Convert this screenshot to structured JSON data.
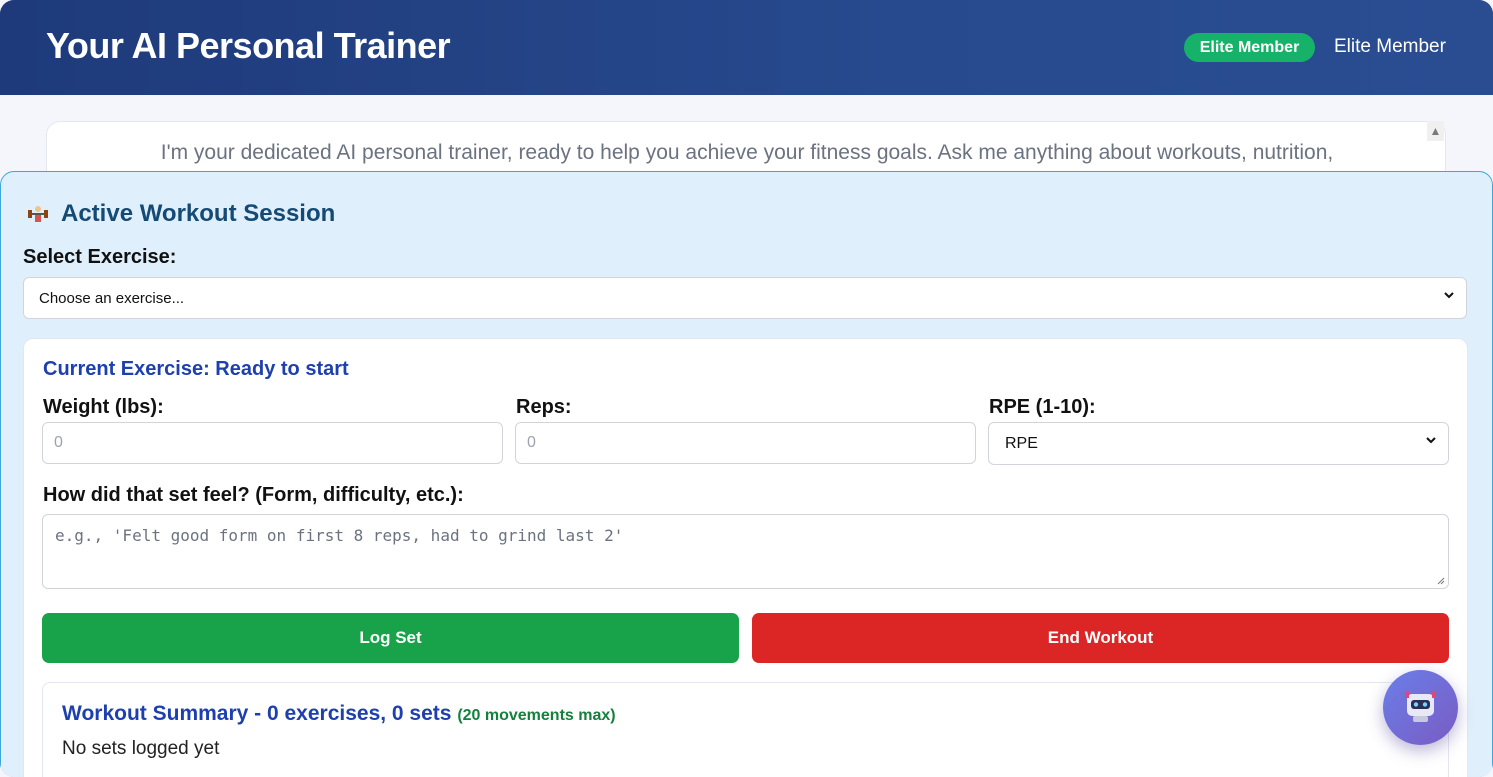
{
  "header": {
    "title": "Your AI Personal Trainer",
    "badge": "Elite Member",
    "member_label": "Elite Member"
  },
  "intro": {
    "text": "I'm your dedicated AI personal trainer, ready to help you achieve your fitness goals. Ask me anything about workouts, nutrition,"
  },
  "workout": {
    "icon": "weightlifter-icon",
    "title": "Active Workout Session",
    "select_label": "Select Exercise:",
    "select_value": "Choose an exercise...",
    "current_exercise": "Current Exercise: Ready to start",
    "weight_label": "Weight (lbs):",
    "weight_placeholder": "0",
    "reps_label": "Reps:",
    "reps_placeholder": "0",
    "rpe_label": "RPE (1-10):",
    "rpe_value": "RPE",
    "feel_label": "How did that set feel? (Form, difficulty, etc.):",
    "feel_placeholder": "e.g., 'Felt good form on first 8 reps, had to grind last 2'",
    "log_button": "Log Set",
    "end_button": "End Workout"
  },
  "summary": {
    "title": "Workout Summary - 0 exercises, 0 sets",
    "max_note": "(20 movements max)",
    "empty": "No sets logged yet"
  },
  "colors": {
    "header": "#274a8e",
    "badge": "#17b26a",
    "log_button": "#18a34a",
    "end_button": "#dc2626",
    "accent_title": "#1e40af"
  }
}
